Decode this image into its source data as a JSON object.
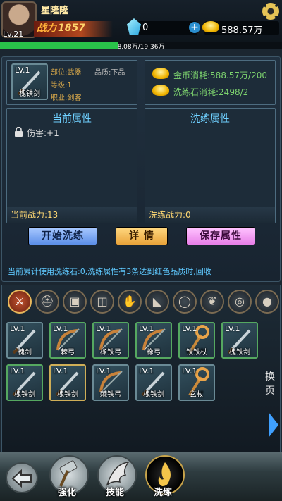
{
  "player": {
    "name": "星隆隆",
    "level": "Lv.21",
    "power_label": "战力",
    "power_value": "1857"
  },
  "currency": {
    "gems": "0",
    "gold": "588.57万"
  },
  "exp": {
    "text": "8.08万/19.36万",
    "fraction": 0.417
  },
  "item": {
    "level": "LV.1",
    "name": "槐铁剑",
    "part": "部位:武器",
    "quality": "品质:下品",
    "grade": "等级:1",
    "job": "职业:剑客"
  },
  "costs": {
    "gold": "金币消耗:588.57万/200",
    "stone": "洗练石消耗:2498/2"
  },
  "current_attrs": {
    "title": "当前属性",
    "line": "伤害:+1",
    "power": "当前战力:13"
  },
  "refine_attrs": {
    "title": "洗练属性",
    "power": "洗练战力:0"
  },
  "buttons": {
    "start": "开始洗练",
    "detail": "详 情",
    "save": "保存属性"
  },
  "notice": "当前累计使用洗练石:0,洗练属性有3条达到红色品质时,回收",
  "categories": [
    {
      "name": "sword-icon",
      "glyph": "⚔"
    },
    {
      "name": "helmet-icon",
      "glyph": "⛑"
    },
    {
      "name": "armor-icon",
      "glyph": "▣"
    },
    {
      "name": "pants-icon",
      "glyph": "◫"
    },
    {
      "name": "glove-icon",
      "glyph": "✋"
    },
    {
      "name": "boot-icon",
      "glyph": "◣"
    },
    {
      "name": "ring-icon",
      "glyph": "◯"
    },
    {
      "name": "necklace-icon",
      "glyph": "❦"
    },
    {
      "name": "bracelet-icon",
      "glyph": "◎"
    },
    {
      "name": "orb-icon",
      "glyph": "●"
    }
  ],
  "inventory": [
    {
      "level": "LV.1",
      "name": "槐剑",
      "border": "normal",
      "kind": "sword"
    },
    {
      "level": "LV.1",
      "name": "棘弓",
      "border": "green",
      "kind": "bow"
    },
    {
      "level": "LV.1",
      "name": "橡铁弓",
      "border": "green",
      "kind": "bow"
    },
    {
      "level": "LV.1",
      "name": "橡弓",
      "border": "green",
      "kind": "bow"
    },
    {
      "level": "LV.1",
      "name": "铁铁杖",
      "border": "green",
      "kind": "staff"
    },
    {
      "level": "LV.1",
      "name": "槐铁剑",
      "border": "green",
      "kind": "sword"
    },
    {
      "level": "LV.1",
      "name": "槐铁剑",
      "border": "green",
      "kind": "sword"
    },
    {
      "level": "LV.1",
      "name": "槐铁剑",
      "border": "gold",
      "kind": "sword"
    },
    {
      "level": "LV.1",
      "name": "棘铁弓",
      "border": "normal",
      "kind": "bow"
    },
    {
      "level": "LV.1",
      "name": "槐铁剑",
      "border": "normal",
      "kind": "sword"
    },
    {
      "level": "LV.1",
      "name": "玄杖",
      "border": "normal",
      "kind": "staff"
    }
  ],
  "swap_label": "换页",
  "nav": {
    "strengthen": "强化",
    "skill": "技能",
    "refine": "洗练"
  }
}
